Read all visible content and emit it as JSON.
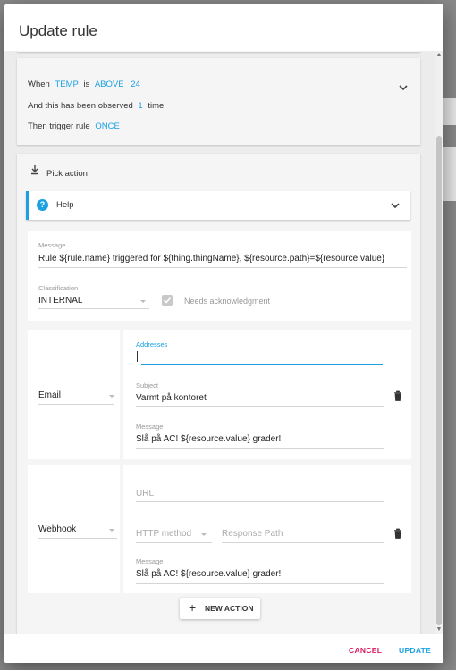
{
  "dialog": {
    "title": "Update rule"
  },
  "condition": {
    "when_label": "When",
    "metric": "TEMP",
    "is_label": "is",
    "comparator": "ABOVE",
    "threshold": "24",
    "observed_prefix": "And this has been observed",
    "observed_count": "1",
    "observed_suffix": "time",
    "trigger_prefix": "Then trigger rule",
    "trigger_mode": "ONCE"
  },
  "action": {
    "pick_label": "Pick action",
    "help_label": "Help",
    "message_label": "Message",
    "message_value": "Rule ${rule.name} triggered for ${thing.thingName}, ${resource.path}=${resource.value}",
    "classification_label": "Classification",
    "classification_value": "INTERNAL",
    "ack_label": "Needs acknowledgment",
    "ack_checked": true
  },
  "email": {
    "type_value": "Email",
    "addresses_label": "Addresses",
    "addresses_value": "",
    "subject_label": "Subject",
    "subject_value": "Varmt på kontoret",
    "message_label": "Message",
    "message_value": "Slå på AC! ${resource.value} grader!"
  },
  "webhook": {
    "type_value": "Webhook",
    "url_placeholder": "URL",
    "method_placeholder": "HTTP method",
    "response_placeholder": "Response Path",
    "message_label": "Message",
    "message_value": "Slå på AC! ${resource.value} grader!"
  },
  "new_action_label": "NEW ACTION",
  "footer": {
    "cancel_label": "CANCEL",
    "update_label": "UPDATE"
  },
  "colors": {
    "accent": "#1ba1e2",
    "cancel": "#d81b60",
    "help_bar": "#1ba1e2"
  }
}
